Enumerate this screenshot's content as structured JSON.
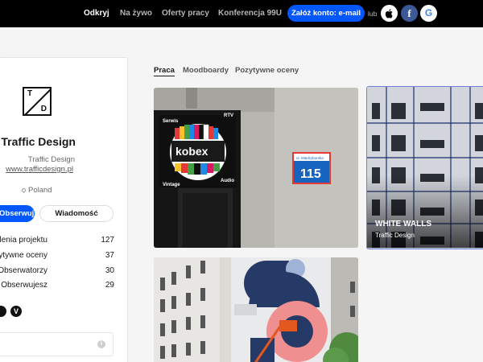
{
  "nav": {
    "links": [
      "Odkryj",
      "Na żywo",
      "Oferty pracy",
      "Konferencja 99U"
    ],
    "signup_label": "Załóż konto: e-mail",
    "or_label": "lub",
    "social_icons": [
      "apple-icon",
      "facebook-icon",
      "google-icon"
    ],
    "social_glyphs": {
      "facebook": "f",
      "google": "G"
    }
  },
  "profile": {
    "logo_letters": {
      "top": "T",
      "bottom": "D"
    },
    "name": "Traffic Design",
    "subtitle": "Traffic Design",
    "url": "www.trafficdesign.pl",
    "location": "Poland",
    "follow_label": "Obserwuj",
    "message_label": "Wiadomość",
    "stats": [
      {
        "label": "Wyświetlenia projektu",
        "value": "127"
      },
      {
        "label": "Pozytywne oceny",
        "value": "37"
      },
      {
        "label": "Obserwatorzy",
        "value": "30"
      },
      {
        "label": "Obserwujesz",
        "value": "29"
      }
    ],
    "links_icons": [
      "behance-icon",
      "vimeo-icon"
    ],
    "vimeo_glyph": "V",
    "info_glyph": "i"
  },
  "tabs": [
    "Praca",
    "Moodboardy",
    "Pozytywne oceny"
  ],
  "projects": [
    {
      "sign_top": "Serwis",
      "sign_right": "RTV",
      "sign_brand": "kobex",
      "sign_bottom_left": "Vintage",
      "sign_bottom_right": "Audio",
      "street_name": "ul. Międzyborska",
      "street_number": "115"
    },
    {
      "title": "WHITE WALLS",
      "owner": "Traffic Design"
    },
    {}
  ],
  "colors": {
    "accent": "#0057ff",
    "topbar": "#000000",
    "page_bg": "#f5f5f5",
    "tile_selected_border": "#6f7fd6"
  }
}
